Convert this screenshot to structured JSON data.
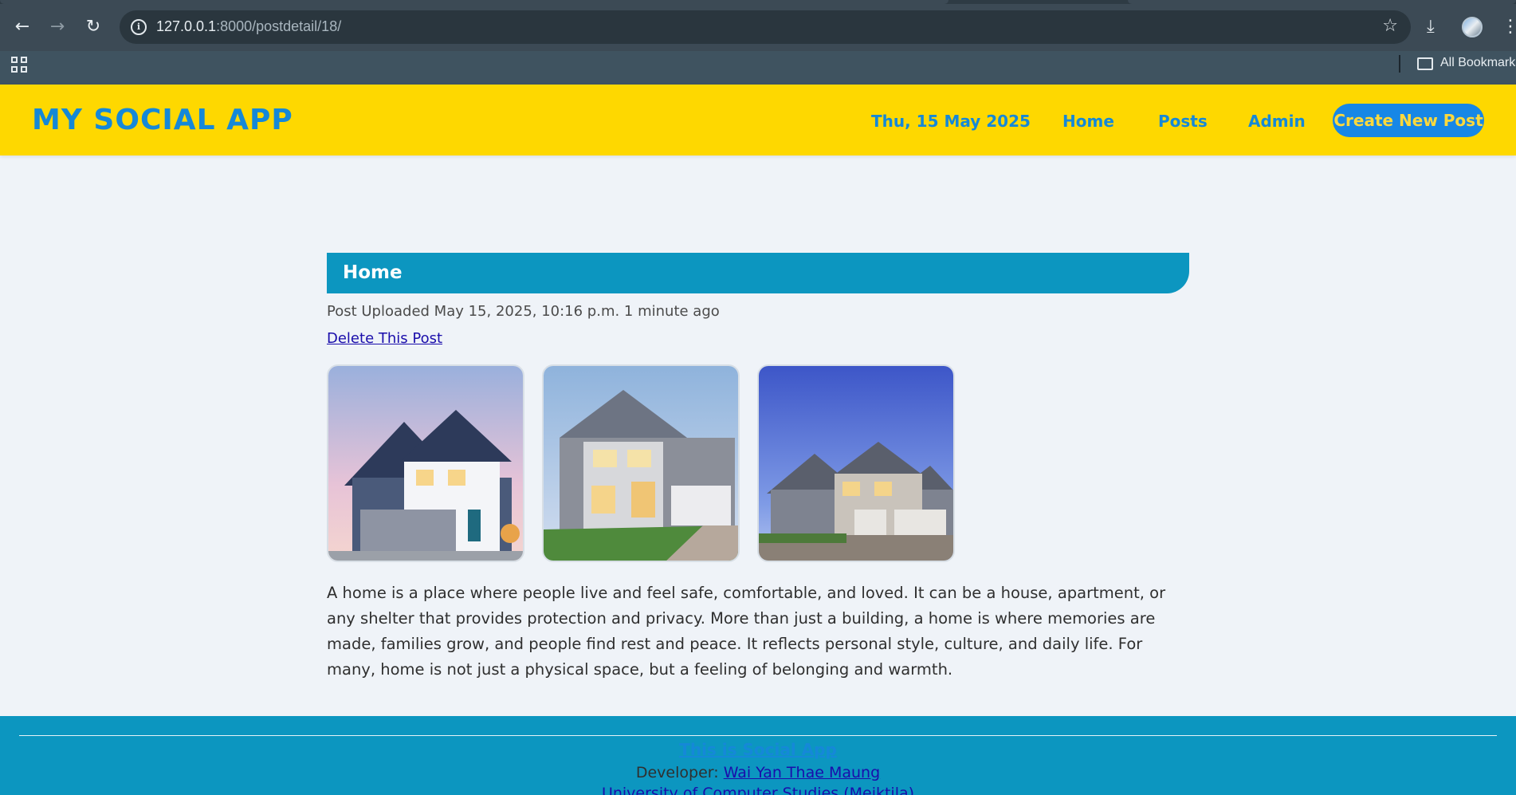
{
  "browser": {
    "url_host": "127.0.0.1",
    "url_rest": ":8000/postdetail/18/",
    "bookmarks_label": "All Bookmarks"
  },
  "header": {
    "logo": "MY SOCIAL APP",
    "date": "Thu, 15 May 2025",
    "nav": [
      "Home",
      "Posts",
      "Admin"
    ],
    "create_button": "Create New Post"
  },
  "post": {
    "title": "Home",
    "meta": "Post Uploaded May 15, 2025, 10:16 p.m. 1 minute ago",
    "delete_link": "Delete This Post",
    "body": "A home is a place where people live and feel safe, comfortable, and loved. It can be a house, apartment, or any shelter that provides protection and privacy. More than just a building, a home is where memories are made, families grow, and people find rest and peace. It reflects personal style, culture, and daily life. For many, home is not just a physical space, but a feeling of belonging and warmth."
  },
  "footer": {
    "title": "This is Social App",
    "developer_label": "Developer: ",
    "developer_name": "Wai Yan Thae Maung",
    "university": "University of Computer Studies (Meiktila)"
  },
  "colors": {
    "header_bg": "#fed800",
    "brand_blue": "#1588d8",
    "title_bar": "#0c96c0",
    "button_bg": "#1787e6",
    "button_text": "#ffd93b"
  },
  "icons": [
    "back-arrow-icon",
    "forward-arrow-icon",
    "reload-icon",
    "site-info-icon",
    "bookmark-star-icon",
    "download-icon",
    "profile-avatar",
    "menu-dots-icon",
    "apps-grid-icon",
    "folder-icon"
  ]
}
